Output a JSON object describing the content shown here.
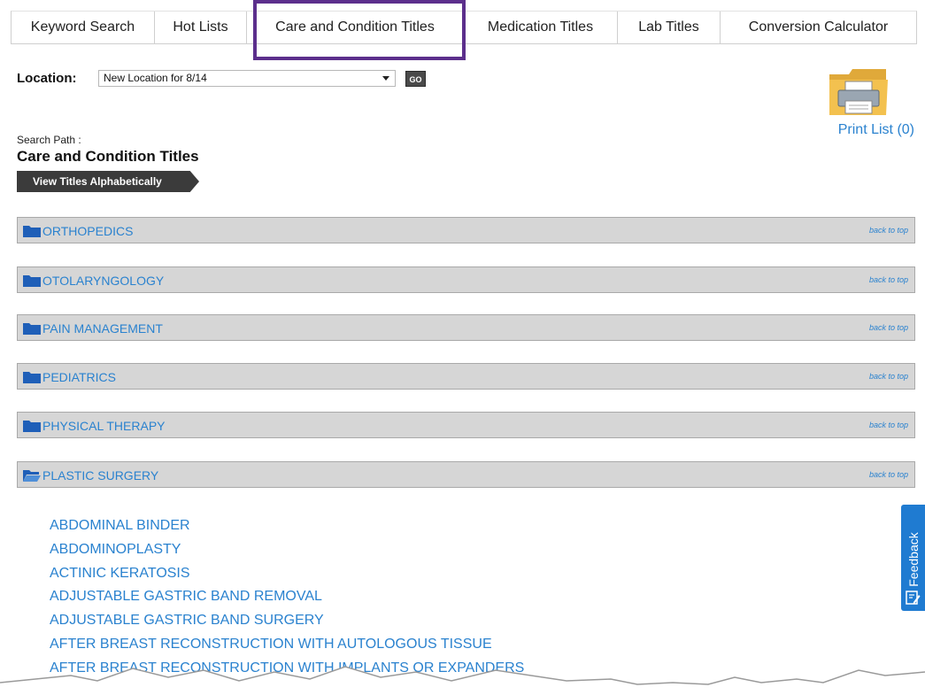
{
  "tabs": [
    {
      "label": "Keyword Search"
    },
    {
      "label": "Hot Lists"
    },
    {
      "label": "Care and Condition Titles"
    },
    {
      "label": "Medication Titles"
    },
    {
      "label": "Lab Titles"
    },
    {
      "label": "Conversion Calculator"
    }
  ],
  "location": {
    "label": "Location:",
    "selected": "New Location for 8/14",
    "go_label": "GO"
  },
  "print_list": {
    "label": "Print List (0)",
    "icon": "printer-folder-icon"
  },
  "search_path": {
    "label": "Search Path :",
    "title": "Care and Condition Titles",
    "view_button": "View Titles Alphabetically"
  },
  "categories": [
    {
      "name": "ORTHOPEDICS",
      "back": "back to top",
      "icon": "folder-closed-icon"
    },
    {
      "name": "OTOLARYNGOLOGY",
      "back": "back to top",
      "icon": "folder-closed-icon"
    },
    {
      "name": "PAIN MANAGEMENT",
      "back": "back to top",
      "icon": "folder-closed-icon"
    },
    {
      "name": "PEDIATRICS",
      "back": "back to top",
      "icon": "folder-closed-icon"
    },
    {
      "name": "PHYSICAL THERAPY",
      "back": "back to top",
      "icon": "folder-closed-icon"
    },
    {
      "name": "PLASTIC SURGERY",
      "back": "back to top",
      "icon": "folder-open-icon"
    }
  ],
  "titles": [
    "ABDOMINAL BINDER",
    "ABDOMINOPLASTY",
    "ACTINIC KERATOSIS",
    "ADJUSTABLE GASTRIC BAND REMOVAL",
    "ADJUSTABLE GASTRIC BAND SURGERY",
    "AFTER BREAST RECONSTRUCTION WITH AUTOLOGOUS TISSUE",
    "AFTER BREAST RECONSTRUCTION WITH IMPLANTS OR EXPANDERS"
  ],
  "feedback": {
    "label": "Feedback",
    "icon": "feedback-edit-icon"
  },
  "colors": {
    "link": "#2a82cf",
    "highlight": "#5c2f8c",
    "feedback": "#1f7bd1"
  }
}
